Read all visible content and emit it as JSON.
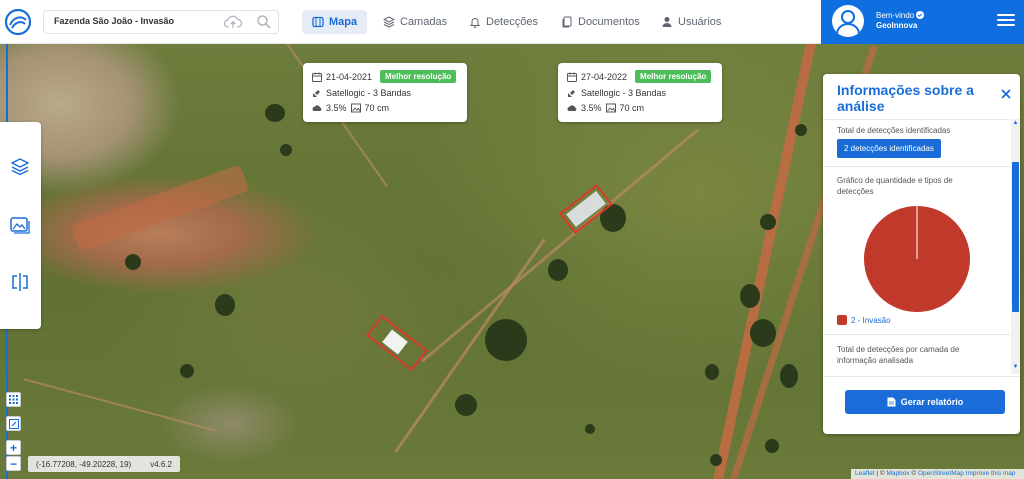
{
  "header": {
    "search_value": "Fazenda São João - Invasão",
    "nav": [
      {
        "label": "Mapa",
        "icon": "map-icon",
        "active": true
      },
      {
        "label": "Camadas",
        "icon": "layers-icon",
        "active": false
      },
      {
        "label": "Detecções",
        "icon": "bell-icon",
        "active": false
      },
      {
        "label": "Documentos",
        "icon": "documents-icon",
        "active": false
      },
      {
        "label": "Usuários",
        "icon": "user-icon",
        "active": false
      }
    ],
    "welcome": "Bem-vindo",
    "user_name": "GeoInnova"
  },
  "image_cards": [
    {
      "date": "21-04-2021",
      "badge": "Melhor resolução",
      "sensor": "Satellogic - 3 Bandas",
      "cloud": "3.5%",
      "resolution": "70 cm"
    },
    {
      "date": "27-04-2022",
      "badge": "Melhor resolução",
      "sensor": "Satellogic - 3 Bandas",
      "cloud": "3.5%",
      "resolution": "70 cm"
    }
  ],
  "map": {
    "coords": "(-16.77208, -49.20228, 19)",
    "version": "v4.6.2",
    "zoom_in": "+",
    "zoom_out": "−",
    "attribution": {
      "leaflet": "Leaflet",
      "sep1": " | © ",
      "mapbox": "Mapbox",
      "sep2": " © ",
      "osm": "OpenStreetMap",
      "improve": "Improve this map"
    }
  },
  "info_panel": {
    "title": "Informações sobre a análise",
    "total_label": "Total de detecções identificadas",
    "total_chip": "2 detecções identificadas",
    "chart_label": "Gráfico de quantidade e tipos de detecções",
    "per_layer_label": "Total de detecções por camada de informação analisada",
    "report_button": "Gerar relatório"
  },
  "chart_data": {
    "type": "pie",
    "slices": [
      {
        "label": "2 - Invasão",
        "value": 2,
        "color": "#c0392b"
      }
    ]
  }
}
